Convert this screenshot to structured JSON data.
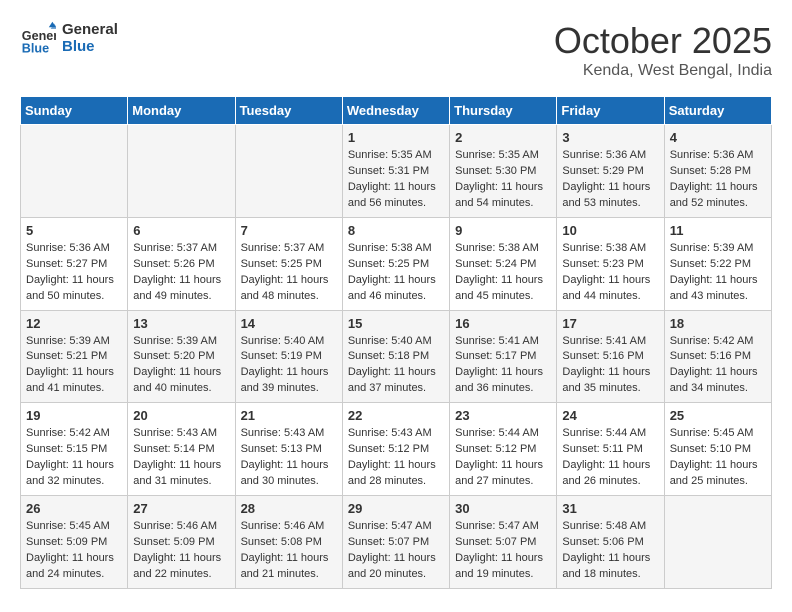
{
  "header": {
    "logo_line1": "General",
    "logo_line2": "Blue",
    "month": "October 2025",
    "location": "Kenda, West Bengal, India"
  },
  "weekdays": [
    "Sunday",
    "Monday",
    "Tuesday",
    "Wednesday",
    "Thursday",
    "Friday",
    "Saturday"
  ],
  "weeks": [
    [
      {
        "day": "",
        "content": ""
      },
      {
        "day": "",
        "content": ""
      },
      {
        "day": "",
        "content": ""
      },
      {
        "day": "1",
        "content": "Sunrise: 5:35 AM\nSunset: 5:31 PM\nDaylight: 11 hours\nand 56 minutes."
      },
      {
        "day": "2",
        "content": "Sunrise: 5:35 AM\nSunset: 5:30 PM\nDaylight: 11 hours\nand 54 minutes."
      },
      {
        "day": "3",
        "content": "Sunrise: 5:36 AM\nSunset: 5:29 PM\nDaylight: 11 hours\nand 53 minutes."
      },
      {
        "day": "4",
        "content": "Sunrise: 5:36 AM\nSunset: 5:28 PM\nDaylight: 11 hours\nand 52 minutes."
      }
    ],
    [
      {
        "day": "5",
        "content": "Sunrise: 5:36 AM\nSunset: 5:27 PM\nDaylight: 11 hours\nand 50 minutes."
      },
      {
        "day": "6",
        "content": "Sunrise: 5:37 AM\nSunset: 5:26 PM\nDaylight: 11 hours\nand 49 minutes."
      },
      {
        "day": "7",
        "content": "Sunrise: 5:37 AM\nSunset: 5:25 PM\nDaylight: 11 hours\nand 48 minutes."
      },
      {
        "day": "8",
        "content": "Sunrise: 5:38 AM\nSunset: 5:25 PM\nDaylight: 11 hours\nand 46 minutes."
      },
      {
        "day": "9",
        "content": "Sunrise: 5:38 AM\nSunset: 5:24 PM\nDaylight: 11 hours\nand 45 minutes."
      },
      {
        "day": "10",
        "content": "Sunrise: 5:38 AM\nSunset: 5:23 PM\nDaylight: 11 hours\nand 44 minutes."
      },
      {
        "day": "11",
        "content": "Sunrise: 5:39 AM\nSunset: 5:22 PM\nDaylight: 11 hours\nand 43 minutes."
      }
    ],
    [
      {
        "day": "12",
        "content": "Sunrise: 5:39 AM\nSunset: 5:21 PM\nDaylight: 11 hours\nand 41 minutes."
      },
      {
        "day": "13",
        "content": "Sunrise: 5:39 AM\nSunset: 5:20 PM\nDaylight: 11 hours\nand 40 minutes."
      },
      {
        "day": "14",
        "content": "Sunrise: 5:40 AM\nSunset: 5:19 PM\nDaylight: 11 hours\nand 39 minutes."
      },
      {
        "day": "15",
        "content": "Sunrise: 5:40 AM\nSunset: 5:18 PM\nDaylight: 11 hours\nand 37 minutes."
      },
      {
        "day": "16",
        "content": "Sunrise: 5:41 AM\nSunset: 5:17 PM\nDaylight: 11 hours\nand 36 minutes."
      },
      {
        "day": "17",
        "content": "Sunrise: 5:41 AM\nSunset: 5:16 PM\nDaylight: 11 hours\nand 35 minutes."
      },
      {
        "day": "18",
        "content": "Sunrise: 5:42 AM\nSunset: 5:16 PM\nDaylight: 11 hours\nand 34 minutes."
      }
    ],
    [
      {
        "day": "19",
        "content": "Sunrise: 5:42 AM\nSunset: 5:15 PM\nDaylight: 11 hours\nand 32 minutes."
      },
      {
        "day": "20",
        "content": "Sunrise: 5:43 AM\nSunset: 5:14 PM\nDaylight: 11 hours\nand 31 minutes."
      },
      {
        "day": "21",
        "content": "Sunrise: 5:43 AM\nSunset: 5:13 PM\nDaylight: 11 hours\nand 30 minutes."
      },
      {
        "day": "22",
        "content": "Sunrise: 5:43 AM\nSunset: 5:12 PM\nDaylight: 11 hours\nand 28 minutes."
      },
      {
        "day": "23",
        "content": "Sunrise: 5:44 AM\nSunset: 5:12 PM\nDaylight: 11 hours\nand 27 minutes."
      },
      {
        "day": "24",
        "content": "Sunrise: 5:44 AM\nSunset: 5:11 PM\nDaylight: 11 hours\nand 26 minutes."
      },
      {
        "day": "25",
        "content": "Sunrise: 5:45 AM\nSunset: 5:10 PM\nDaylight: 11 hours\nand 25 minutes."
      }
    ],
    [
      {
        "day": "26",
        "content": "Sunrise: 5:45 AM\nSunset: 5:09 PM\nDaylight: 11 hours\nand 24 minutes."
      },
      {
        "day": "27",
        "content": "Sunrise: 5:46 AM\nSunset: 5:09 PM\nDaylight: 11 hours\nand 22 minutes."
      },
      {
        "day": "28",
        "content": "Sunrise: 5:46 AM\nSunset: 5:08 PM\nDaylight: 11 hours\nand 21 minutes."
      },
      {
        "day": "29",
        "content": "Sunrise: 5:47 AM\nSunset: 5:07 PM\nDaylight: 11 hours\nand 20 minutes."
      },
      {
        "day": "30",
        "content": "Sunrise: 5:47 AM\nSunset: 5:07 PM\nDaylight: 11 hours\nand 19 minutes."
      },
      {
        "day": "31",
        "content": "Sunrise: 5:48 AM\nSunset: 5:06 PM\nDaylight: 11 hours\nand 18 minutes."
      },
      {
        "day": "",
        "content": ""
      }
    ]
  ]
}
